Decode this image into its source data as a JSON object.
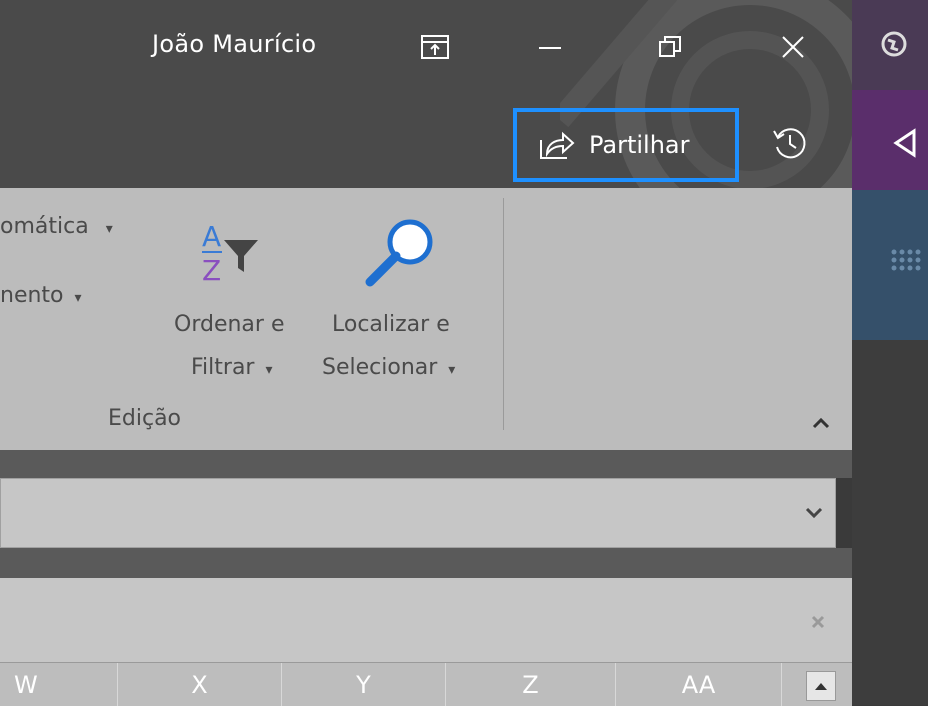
{
  "titlebar": {
    "user_name": "João Maurício",
    "share_label": "Partilhar"
  },
  "ribbon": {
    "autosum_fragment": "omática",
    "fill_fragment": "nento",
    "sort_filter_line1": "Ordenar e",
    "sort_filter_line2": "Filtrar",
    "find_select_line1": "Localizar e",
    "find_select_line2": "Selecionar",
    "group_label": "Edição"
  },
  "columns": [
    "W",
    "X",
    "Y",
    "Z",
    "AA"
  ],
  "colors": {
    "accent_border": "#1e90ff",
    "sort_a": "#3a7bd5",
    "sort_z": "#8a4fbf",
    "search_blue": "#1e6fd0"
  }
}
